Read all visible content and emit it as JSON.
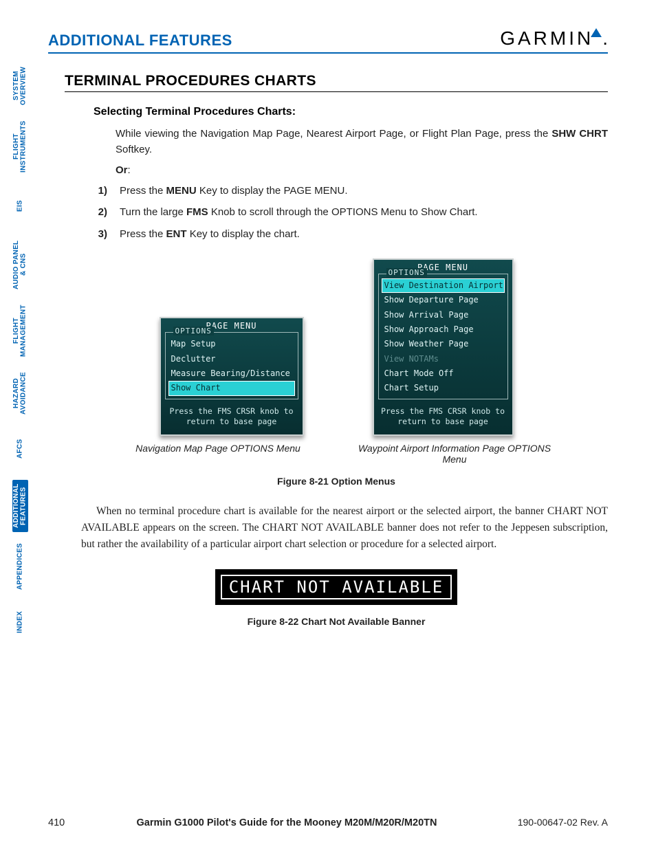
{
  "header": {
    "section_title": "ADDITIONAL FEATURES",
    "logo_text": "GARMIN"
  },
  "tabs": [
    {
      "label": "SYSTEM\nOVERVIEW",
      "active": false
    },
    {
      "label": "FLIGHT\nINSTRUMENTS",
      "active": false
    },
    {
      "label": "EIS",
      "active": false
    },
    {
      "label": "AUDIO PANEL\n& CNS",
      "active": false
    },
    {
      "label": "FLIGHT\nMANAGEMENT",
      "active": false
    },
    {
      "label": "HAZARD\nAVOIDANCE",
      "active": false
    },
    {
      "label": "AFCS",
      "active": false
    },
    {
      "label": "ADDITIONAL\nFEATURES",
      "active": true
    },
    {
      "label": "APPENDICES",
      "active": false
    },
    {
      "label": "INDEX",
      "active": false
    }
  ],
  "section_heading": "TERMINAL PROCEDURES CHARTS",
  "subheading": "Selecting Terminal Procedures Charts:",
  "intro_text_pre": "While viewing the Navigation Map Page, Nearest Airport Page, or Flight Plan Page, press the ",
  "intro_text_bold": "SHW CHRT",
  "intro_text_post": " Softkey.",
  "or_label": "Or",
  "steps": [
    {
      "n": "1)",
      "pre": "Press the ",
      "b": "MENU",
      "post": " Key to display the PAGE MENU."
    },
    {
      "n": "2)",
      "pre": "Turn the large ",
      "b": "FMS",
      "post": " Knob to scroll through the OPTIONS Menu to Show Chart."
    },
    {
      "n": "3)",
      "pre": "Press the ",
      "b": "ENT",
      "post": " Key to display the chart."
    }
  ],
  "menus": {
    "left": {
      "title": "PAGE MENU",
      "group_label": "OPTIONS",
      "items": [
        {
          "text": "Map Setup",
          "sel": false,
          "dim": false
        },
        {
          "text": "Declutter",
          "sel": false,
          "dim": false
        },
        {
          "text": "Measure Bearing/Distance",
          "sel": false,
          "dim": false
        },
        {
          "text": "Show Chart",
          "sel": true,
          "dim": false
        }
      ],
      "hint_l1": "Press the FMS CRSR knob to",
      "hint_l2": "return to base page",
      "caption": "Navigation Map Page OPTIONS Menu"
    },
    "right": {
      "title": "PAGE MENU",
      "group_label": "OPTIONS",
      "items": [
        {
          "text": "View Destination Airport",
          "sel": true,
          "dim": false
        },
        {
          "text": "Show Departure Page",
          "sel": false,
          "dim": false
        },
        {
          "text": "Show Arrival Page",
          "sel": false,
          "dim": false
        },
        {
          "text": "Show Approach Page",
          "sel": false,
          "dim": false
        },
        {
          "text": "Show Weather Page",
          "sel": false,
          "dim": false
        },
        {
          "text": "View NOTAMs",
          "sel": false,
          "dim": true
        },
        {
          "text": "Chart Mode Off",
          "sel": false,
          "dim": false
        },
        {
          "text": "Chart Setup",
          "sel": false,
          "dim": false
        }
      ],
      "hint_l1": "Press the FMS CRSR knob to",
      "hint_l2": "return to base page",
      "caption": "Waypoint Airport Information Page OPTIONS Menu"
    }
  },
  "figure1_label": "Figure 8-21  Option Menus",
  "paragraph2": "When no terminal procedure chart is available for the nearest airport or the selected airport, the banner CHART NOT AVAILABLE appears on the screen.  The CHART NOT AVAILABLE banner does not refer to the Jeppesen subscription, but rather the availability of a particular airport chart selection or procedure for a selected airport.",
  "banner_text": "CHART NOT AVAILABLE",
  "figure2_label": "Figure 8-22  Chart Not Available Banner",
  "footer": {
    "page": "410",
    "title": "Garmin G1000 Pilot's Guide for the Mooney M20M/M20R/M20TN",
    "rev": "190-00647-02  Rev. A"
  }
}
